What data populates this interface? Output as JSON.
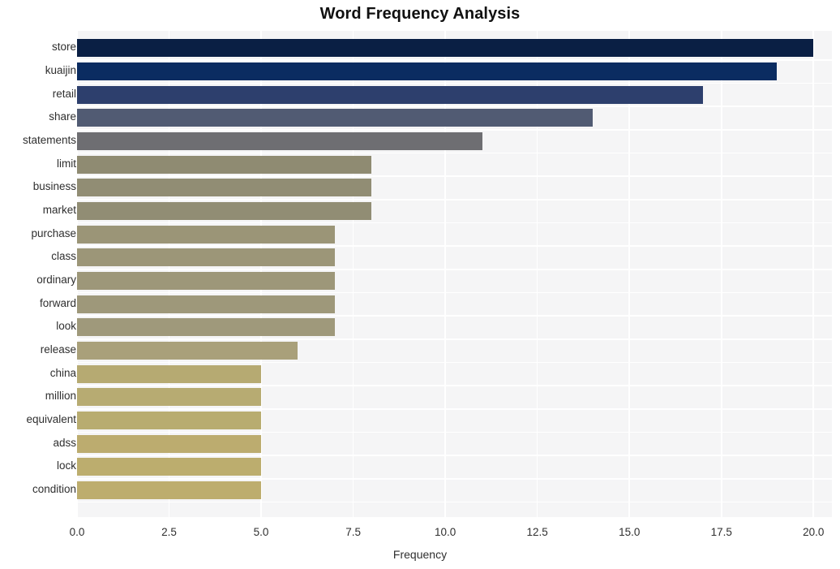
{
  "chart_data": {
    "type": "bar",
    "orientation": "horizontal",
    "title": "Word Frequency Analysis",
    "xlabel": "Frequency",
    "ylabel": "",
    "xlim": [
      0.0,
      20.5
    ],
    "ylim": [
      0,
      20
    ],
    "grid": true,
    "legend": null,
    "xticks": [
      "0.0",
      "2.5",
      "5.0",
      "7.5",
      "10.0",
      "12.5",
      "15.0",
      "17.5",
      "20.0"
    ],
    "xtick_values": [
      0.0,
      2.5,
      5.0,
      7.5,
      10.0,
      12.5,
      15.0,
      17.5,
      20.0
    ],
    "categories": [
      "store",
      "kuaijin",
      "retail",
      "share",
      "statements",
      "limit",
      "business",
      "market",
      "purchase",
      "class",
      "ordinary",
      "forward",
      "look",
      "release",
      "china",
      "million",
      "equivalent",
      "adss",
      "lock",
      "condition"
    ],
    "values": [
      20,
      19,
      17,
      14,
      11,
      8,
      8,
      8,
      7,
      7,
      7,
      7,
      7,
      6,
      5,
      5,
      5,
      5,
      5,
      5
    ],
    "bar_colors": [
      "#0a1f44",
      "#0b2c61",
      "#2d3f6d",
      "#515b73",
      "#6e6e72",
      "#8f8b72",
      "#918d74",
      "#918d74",
      "#9b9577",
      "#9c9678",
      "#9d9779",
      "#9e987a",
      "#9f997b",
      "#a9a07a",
      "#b6aa72",
      "#b7ab72",
      "#b8ac70",
      "#bcac6f",
      "#bcad6e",
      "#bdad6e"
    ],
    "plot_background": "#f5f5f6",
    "gridline_color": "#ffffff",
    "figure_background": "#ffffff"
  }
}
